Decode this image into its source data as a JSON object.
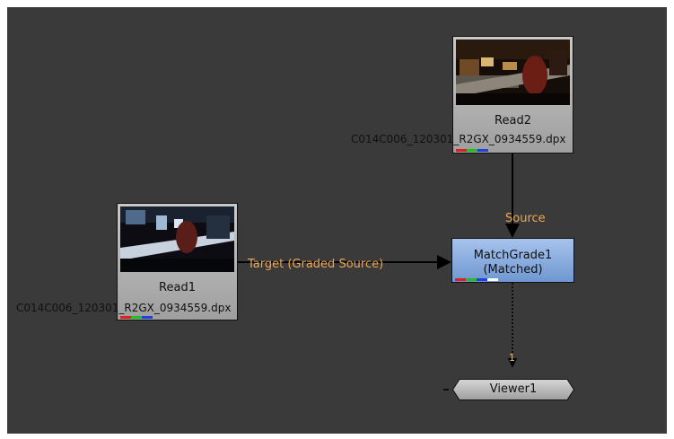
{
  "nodes": {
    "read2": {
      "name": "Read2",
      "file": "C014C006_120301_R2GX_0934559.dpx"
    },
    "read1": {
      "name": "Read1",
      "file": "C014C006_120301_R2GX_0934559.dpx"
    },
    "matchgrade": {
      "name": "MatchGrade1",
      "sub": "(Matched)"
    },
    "viewer": {
      "name": "Viewer1",
      "input_index": "1"
    }
  },
  "edges": {
    "source_label": "Source",
    "target_label": "Target (Graded Source)"
  },
  "colors": {
    "background": "#3a3a3a",
    "read_node": "#b5b5b5",
    "matchgrade_node": "#8db0e0",
    "edge_label": "#f0a64e",
    "channel_red": "#e02020",
    "channel_green": "#20c020",
    "channel_blue": "#2040e0"
  }
}
